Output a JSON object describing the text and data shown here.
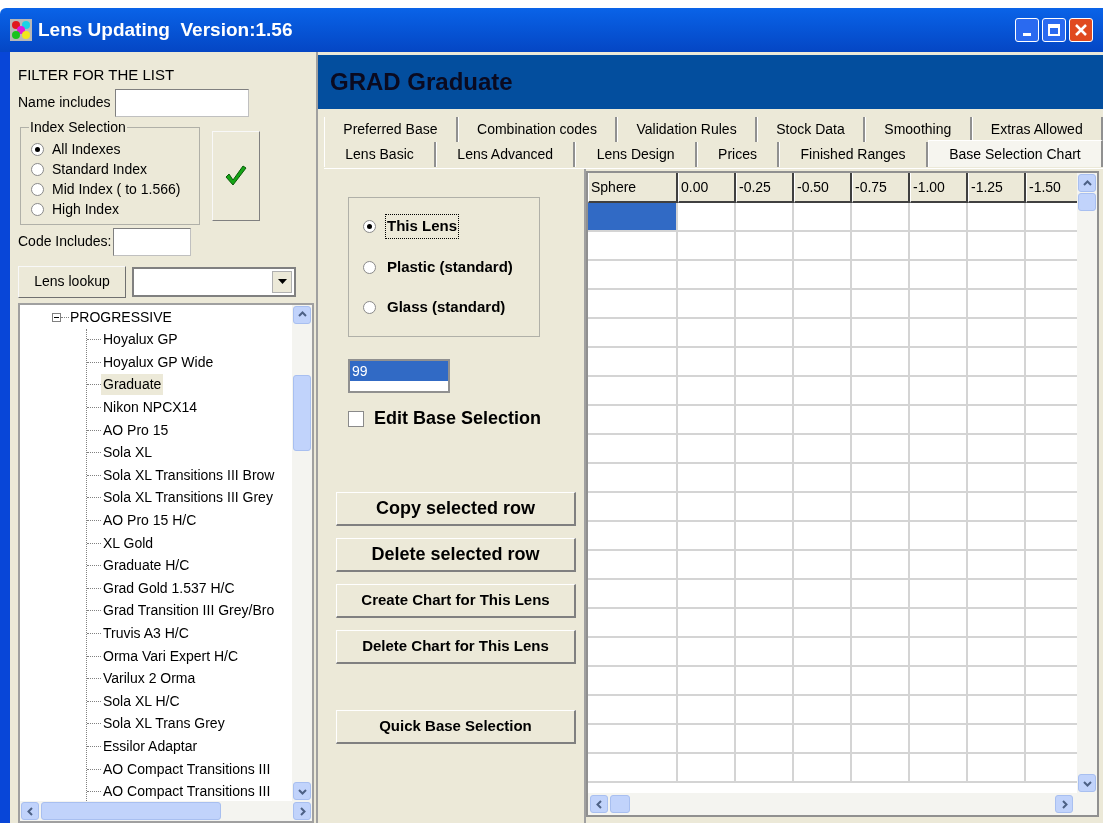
{
  "window": {
    "title": "Lens Updating  Version:1.56"
  },
  "filter": {
    "heading": "FILTER FOR THE LIST",
    "name_label": "Name includes",
    "code_label": "Code Includes:",
    "lookup_button": "Lens lookup",
    "index_group": {
      "title": "Index Selection",
      "options": [
        {
          "label": "All Indexes",
          "selected": true
        },
        {
          "label": "Standard Index",
          "selected": false
        },
        {
          "label": "Mid Index ( to 1.566)",
          "selected": false
        },
        {
          "label": "High Index",
          "selected": false
        }
      ]
    }
  },
  "tree": {
    "items": [
      {
        "label": "PROGRESSIVE",
        "expanded": true,
        "children": [
          {
            "label": "Hoyalux GP",
            "selected": false
          },
          {
            "label": "Hoyalux GP Wide",
            "selected": false
          },
          {
            "label": "Graduate",
            "selected": true
          },
          {
            "label": "Nikon NPCX14",
            "selected": false
          },
          {
            "label": "AO Pro 15",
            "selected": false
          },
          {
            "label": "Sola XL",
            "selected": false
          },
          {
            "label": "Sola XL Transitions III Brow",
            "selected": false
          },
          {
            "label": "Sola XL Transitions III Grey",
            "selected": false
          },
          {
            "label": "AO Pro 15 H/C",
            "selected": false
          },
          {
            "label": "XL Gold",
            "selected": false
          },
          {
            "label": "Graduate H/C",
            "selected": false
          },
          {
            "label": "Grad Gold 1.537 H/C",
            "selected": false
          },
          {
            "label": "Grad Transition III Grey/Bro",
            "selected": false
          },
          {
            "label": "Truvis A3 H/C",
            "selected": false
          },
          {
            "label": "Orma Vari Expert H/C",
            "selected": false
          },
          {
            "label": "Varilux 2 Orma",
            "selected": false
          },
          {
            "label": "Sola XL H/C",
            "selected": false
          },
          {
            "label": "Sola XL Trans Grey",
            "selected": false
          },
          {
            "label": "Essilor Adaptar",
            "selected": false
          },
          {
            "label": "AO Compact Transitions III",
            "selected": false
          },
          {
            "label": "AO Compact Transitions III",
            "selected": false
          }
        ]
      }
    ]
  },
  "panel": {
    "header": "GRAD Graduate",
    "tab_rows": [
      [
        {
          "label": "Preferred Base",
          "selected": false
        },
        {
          "label": "Combination codes",
          "selected": false
        },
        {
          "label": "Validation Rules",
          "selected": false
        },
        {
          "label": "Stock Data",
          "selected": false
        },
        {
          "label": "Smoothing",
          "selected": false
        },
        {
          "label": "Extras Allowed",
          "selected": false
        }
      ],
      [
        {
          "label": "Lens Basic",
          "selected": false
        },
        {
          "label": "Lens Advanced",
          "selected": false
        },
        {
          "label": "Lens Design",
          "selected": false
        },
        {
          "label": "Prices",
          "selected": false
        },
        {
          "label": "Finished Ranges",
          "selected": false
        },
        {
          "label": "Base Selection Chart",
          "selected": true
        }
      ]
    ],
    "base_options": [
      {
        "label": "This Lens",
        "selected": true
      },
      {
        "label": "Plastic (standard)",
        "selected": false
      },
      {
        "label": "Glass (standard)",
        "selected": false
      }
    ],
    "list_items": [
      {
        "label": "99",
        "selected": true
      }
    ],
    "edit_checkbox": {
      "label": "Edit Base Selection",
      "checked": false
    },
    "buttons": [
      {
        "label": "Copy selected row",
        "kind": "large"
      },
      {
        "label": "Delete selected row",
        "kind": "large"
      },
      {
        "label": "Create Chart for This Lens",
        "kind": "small"
      },
      {
        "label": "Delete Chart for This Lens",
        "kind": "small"
      },
      {
        "label": "Quick Base Selection",
        "kind": "small"
      }
    ],
    "grid": {
      "columns": [
        "Sphere",
        "0.00",
        "-0.25",
        "-0.50",
        "-0.75",
        "-1.00",
        "-1.25",
        "-1.50"
      ],
      "rows": [
        {
          "selected": true
        },
        {
          "selected": false
        },
        {
          "selected": false
        },
        {
          "selected": false
        },
        {
          "selected": false
        },
        {
          "selected": false
        },
        {
          "selected": false
        },
        {
          "selected": false
        },
        {
          "selected": false
        },
        {
          "selected": false
        },
        {
          "selected": false
        },
        {
          "selected": false
        },
        {
          "selected": false
        },
        {
          "selected": false
        },
        {
          "selected": false
        },
        {
          "selected": false
        },
        {
          "selected": false
        },
        {
          "selected": false
        },
        {
          "selected": false
        },
        {
          "selected": false
        }
      ]
    }
  }
}
